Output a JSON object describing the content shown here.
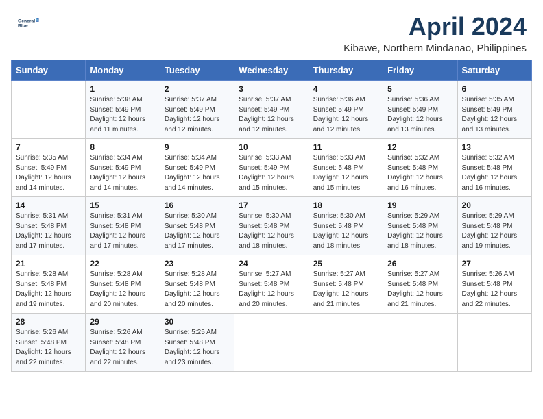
{
  "header": {
    "logo_line1": "General",
    "logo_line2": "Blue",
    "month": "April 2024",
    "location": "Kibawe, Northern Mindanao, Philippines"
  },
  "weekdays": [
    "Sunday",
    "Monday",
    "Tuesday",
    "Wednesday",
    "Thursday",
    "Friday",
    "Saturday"
  ],
  "weeks": [
    [
      {
        "day": "",
        "info": ""
      },
      {
        "day": "1",
        "info": "Sunrise: 5:38 AM\nSunset: 5:49 PM\nDaylight: 12 hours\nand 11 minutes."
      },
      {
        "day": "2",
        "info": "Sunrise: 5:37 AM\nSunset: 5:49 PM\nDaylight: 12 hours\nand 12 minutes."
      },
      {
        "day": "3",
        "info": "Sunrise: 5:37 AM\nSunset: 5:49 PM\nDaylight: 12 hours\nand 12 minutes."
      },
      {
        "day": "4",
        "info": "Sunrise: 5:36 AM\nSunset: 5:49 PM\nDaylight: 12 hours\nand 12 minutes."
      },
      {
        "day": "5",
        "info": "Sunrise: 5:36 AM\nSunset: 5:49 PM\nDaylight: 12 hours\nand 13 minutes."
      },
      {
        "day": "6",
        "info": "Sunrise: 5:35 AM\nSunset: 5:49 PM\nDaylight: 12 hours\nand 13 minutes."
      }
    ],
    [
      {
        "day": "7",
        "info": "Sunrise: 5:35 AM\nSunset: 5:49 PM\nDaylight: 12 hours\nand 14 minutes."
      },
      {
        "day": "8",
        "info": "Sunrise: 5:34 AM\nSunset: 5:49 PM\nDaylight: 12 hours\nand 14 minutes."
      },
      {
        "day": "9",
        "info": "Sunrise: 5:34 AM\nSunset: 5:49 PM\nDaylight: 12 hours\nand 14 minutes."
      },
      {
        "day": "10",
        "info": "Sunrise: 5:33 AM\nSunset: 5:49 PM\nDaylight: 12 hours\nand 15 minutes."
      },
      {
        "day": "11",
        "info": "Sunrise: 5:33 AM\nSunset: 5:48 PM\nDaylight: 12 hours\nand 15 minutes."
      },
      {
        "day": "12",
        "info": "Sunrise: 5:32 AM\nSunset: 5:48 PM\nDaylight: 12 hours\nand 16 minutes."
      },
      {
        "day": "13",
        "info": "Sunrise: 5:32 AM\nSunset: 5:48 PM\nDaylight: 12 hours\nand 16 minutes."
      }
    ],
    [
      {
        "day": "14",
        "info": "Sunrise: 5:31 AM\nSunset: 5:48 PM\nDaylight: 12 hours\nand 17 minutes."
      },
      {
        "day": "15",
        "info": "Sunrise: 5:31 AM\nSunset: 5:48 PM\nDaylight: 12 hours\nand 17 minutes."
      },
      {
        "day": "16",
        "info": "Sunrise: 5:30 AM\nSunset: 5:48 PM\nDaylight: 12 hours\nand 17 minutes."
      },
      {
        "day": "17",
        "info": "Sunrise: 5:30 AM\nSunset: 5:48 PM\nDaylight: 12 hours\nand 18 minutes."
      },
      {
        "day": "18",
        "info": "Sunrise: 5:30 AM\nSunset: 5:48 PM\nDaylight: 12 hours\nand 18 minutes."
      },
      {
        "day": "19",
        "info": "Sunrise: 5:29 AM\nSunset: 5:48 PM\nDaylight: 12 hours\nand 18 minutes."
      },
      {
        "day": "20",
        "info": "Sunrise: 5:29 AM\nSunset: 5:48 PM\nDaylight: 12 hours\nand 19 minutes."
      }
    ],
    [
      {
        "day": "21",
        "info": "Sunrise: 5:28 AM\nSunset: 5:48 PM\nDaylight: 12 hours\nand 19 minutes."
      },
      {
        "day": "22",
        "info": "Sunrise: 5:28 AM\nSunset: 5:48 PM\nDaylight: 12 hours\nand 20 minutes."
      },
      {
        "day": "23",
        "info": "Sunrise: 5:28 AM\nSunset: 5:48 PM\nDaylight: 12 hours\nand 20 minutes."
      },
      {
        "day": "24",
        "info": "Sunrise: 5:27 AM\nSunset: 5:48 PM\nDaylight: 12 hours\nand 20 minutes."
      },
      {
        "day": "25",
        "info": "Sunrise: 5:27 AM\nSunset: 5:48 PM\nDaylight: 12 hours\nand 21 minutes."
      },
      {
        "day": "26",
        "info": "Sunrise: 5:27 AM\nSunset: 5:48 PM\nDaylight: 12 hours\nand 21 minutes."
      },
      {
        "day": "27",
        "info": "Sunrise: 5:26 AM\nSunset: 5:48 PM\nDaylight: 12 hours\nand 22 minutes."
      }
    ],
    [
      {
        "day": "28",
        "info": "Sunrise: 5:26 AM\nSunset: 5:48 PM\nDaylight: 12 hours\nand 22 minutes."
      },
      {
        "day": "29",
        "info": "Sunrise: 5:26 AM\nSunset: 5:48 PM\nDaylight: 12 hours\nand 22 minutes."
      },
      {
        "day": "30",
        "info": "Sunrise: 5:25 AM\nSunset: 5:48 PM\nDaylight: 12 hours\nand 23 minutes."
      },
      {
        "day": "",
        "info": ""
      },
      {
        "day": "",
        "info": ""
      },
      {
        "day": "",
        "info": ""
      },
      {
        "day": "",
        "info": ""
      }
    ]
  ]
}
